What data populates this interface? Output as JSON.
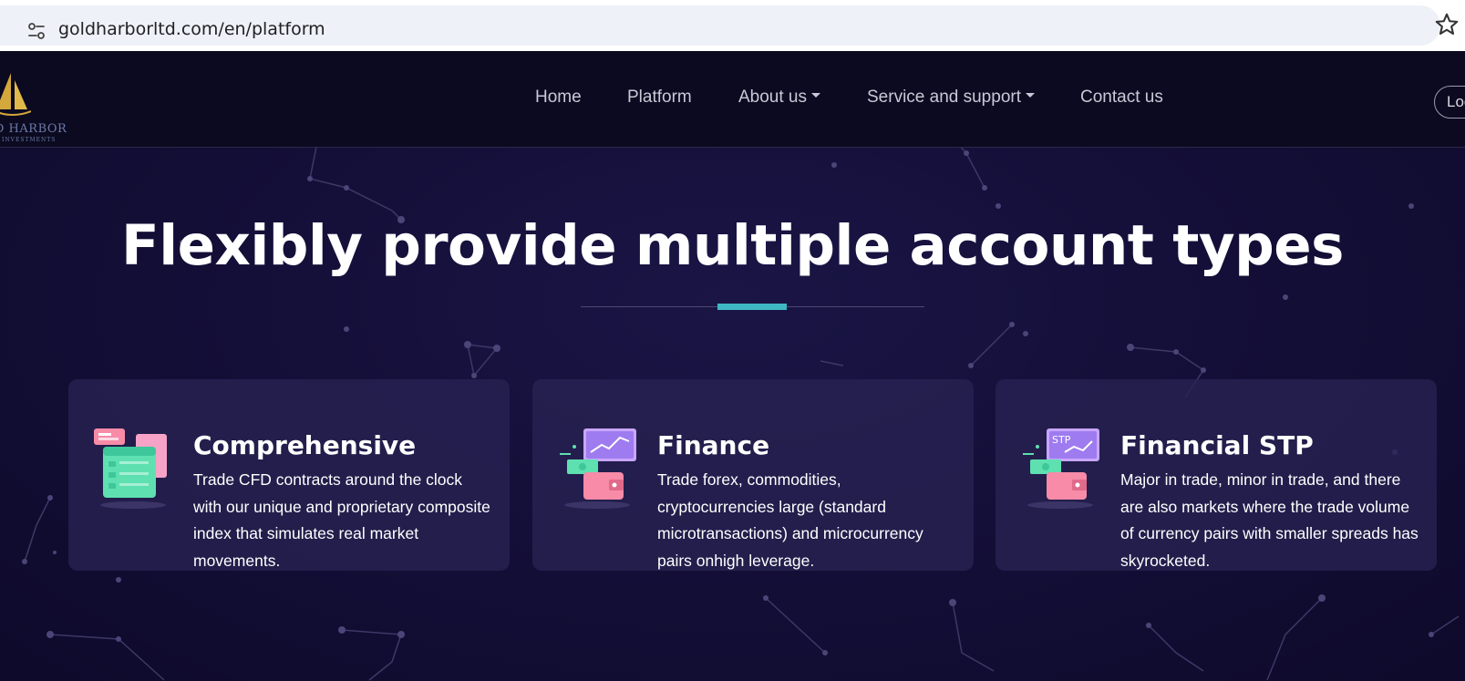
{
  "browser": {
    "url": "goldharborltd.com/en/platform",
    "site_info_icon": "site-info-icon",
    "bookmark_icon": "star-icon"
  },
  "header": {
    "logo": {
      "icon": "sailboat-logo-icon",
      "text": "D HARBOR",
      "subtext": "INVESTMENTS"
    },
    "nav": [
      {
        "label": "Home",
        "has_dropdown": false
      },
      {
        "label": "Platform",
        "has_dropdown": false
      },
      {
        "label": "About us",
        "has_dropdown": true
      },
      {
        "label": "Service and support",
        "has_dropdown": true
      },
      {
        "label": "Contact us",
        "has_dropdown": false
      }
    ],
    "login_label": "Log"
  },
  "hero": {
    "title": "Flexibly provide multiple account types"
  },
  "cards": [
    {
      "title": "Comprehensive",
      "description": "Trade CFD contracts around the clock with our unique and proprietary composite index that simulates real market movements.",
      "icon": "documents-illustration-icon"
    },
    {
      "title": "Finance",
      "description": "Trade forex, commodities, cryptocurrencies large (standard microtransactions) and microcurrency pairs onhigh leverage.",
      "icon": "wallet-chart-illustration-icon"
    },
    {
      "title": "Financial STP",
      "description": "Major in trade, minor in trade, and there are also markets where the trade volume of currency pairs with smaller spreads has skyrocketed.",
      "icon": "stp-wallet-illustration-icon",
      "icon_label": "STP"
    }
  ],
  "colors": {
    "background": "#130e36",
    "header_bg": "#0b0a20",
    "accent": "#3fb8c4",
    "card_bg": "#282252",
    "logo_gold": "#d4a83a"
  }
}
